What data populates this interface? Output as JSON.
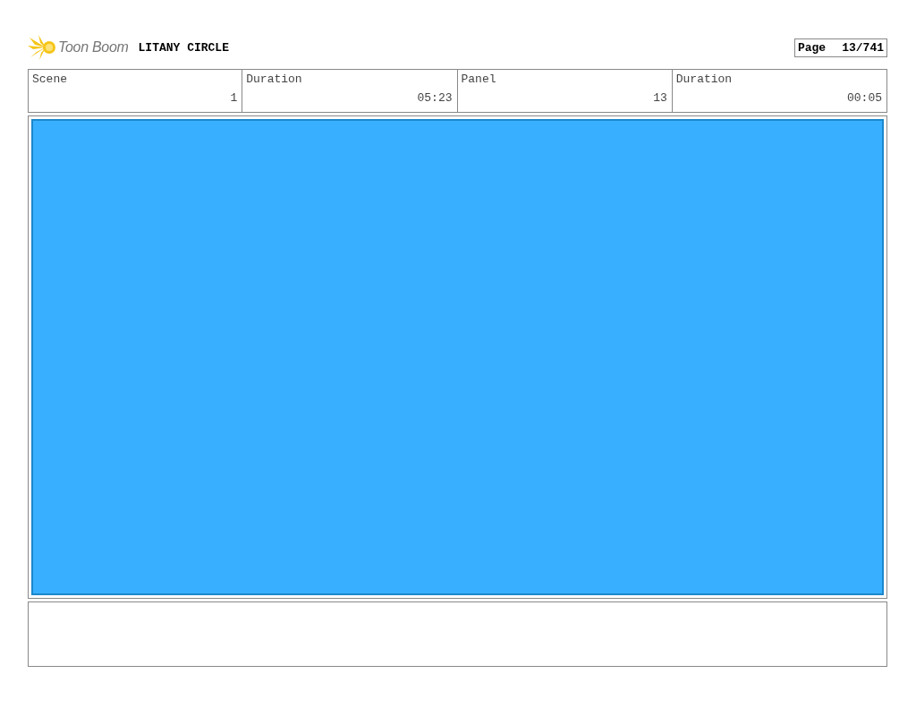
{
  "header": {
    "logo_text": "Toon Boom",
    "title": "LITANY CIRCLE",
    "page_label": "Page",
    "page_number": "13/741"
  },
  "info_table": {
    "columns": [
      "Scene",
      "Duration",
      "Panel",
      "Duration"
    ],
    "rows": [
      [
        "1",
        "05:23",
        "13",
        "00:05"
      ]
    ]
  },
  "panel": {
    "kind": "blank"
  }
}
